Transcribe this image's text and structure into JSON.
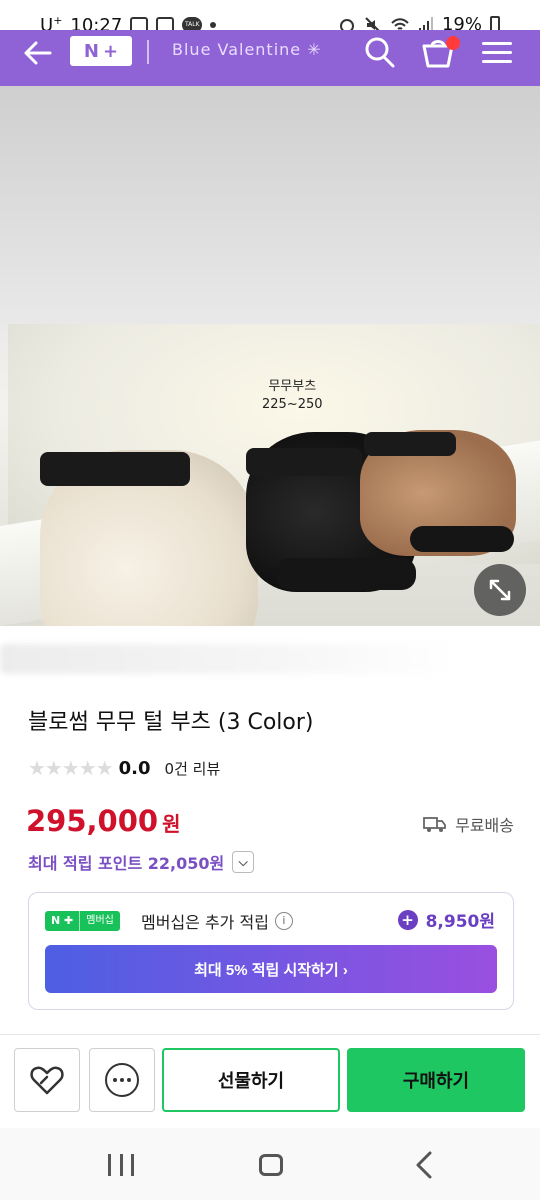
{
  "status_bar": {
    "carrier": "U",
    "carrier_sup": "+",
    "time": "10:27",
    "talk_label": "TALK",
    "battery": "19%"
  },
  "header": {
    "logo": {
      "left": "N",
      "right": "+"
    },
    "store_name": "Blue Valentine ✳",
    "color": "#8f63d6"
  },
  "gallery": {
    "label_line1": "무무부츠",
    "label_line2": "225~250",
    "slide_count": 5,
    "active_slide": 1
  },
  "product": {
    "title": "블로썸 무무 털 부츠 (3 Color)",
    "stars": "★★★★★",
    "rating": "0.0",
    "review_count": "0건 리뷰",
    "price": "295,000",
    "price_unit": "원",
    "shipping": "무료배송",
    "max_points": "최대 적립 포인트 22,050원",
    "price_color": "#d0112b"
  },
  "membership": {
    "badge_np": "N ✚",
    "badge_label": "멤버십",
    "text": "멤버십은 추가 적립",
    "info": "i",
    "points": "8,950원",
    "cta": "최대 5% 적립 시작하기 ›"
  },
  "actions": {
    "gift": "선물하기",
    "buy": "구매하기",
    "accent": "#1fc763"
  },
  "icons": [
    "back-arrow-icon",
    "search-icon",
    "cart-icon",
    "menu-icon",
    "expand-icon",
    "truck-icon",
    "chevron-down-icon",
    "info-icon",
    "plus-circle-icon",
    "heart-icon",
    "talk-icon",
    "recent-apps-icon",
    "home-icon",
    "back-icon"
  ]
}
